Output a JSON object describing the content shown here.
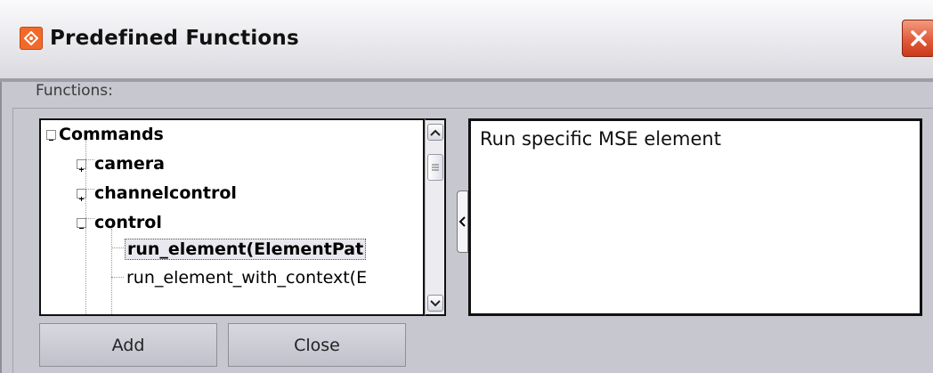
{
  "window": {
    "title": "Predefined Functions",
    "app_icon": "app-logo-icon",
    "close_icon": "close-icon"
  },
  "functions_label": "Functions:",
  "tree": {
    "root": "Commands",
    "groups": [
      {
        "label": "camera",
        "expanded": false
      },
      {
        "label": "channelcontrol",
        "expanded": false
      },
      {
        "label": "control",
        "expanded": true
      }
    ],
    "leaves": [
      {
        "label": "run_element(ElementPat",
        "selected": true
      },
      {
        "label": "run_element_with_context(E",
        "selected": false
      }
    ]
  },
  "description": "Run specific MSE element",
  "buttons": {
    "add": "Add",
    "close": "Close"
  },
  "colors": {
    "close_button": "#e25b3a",
    "app_icon": "#f26a2a"
  }
}
